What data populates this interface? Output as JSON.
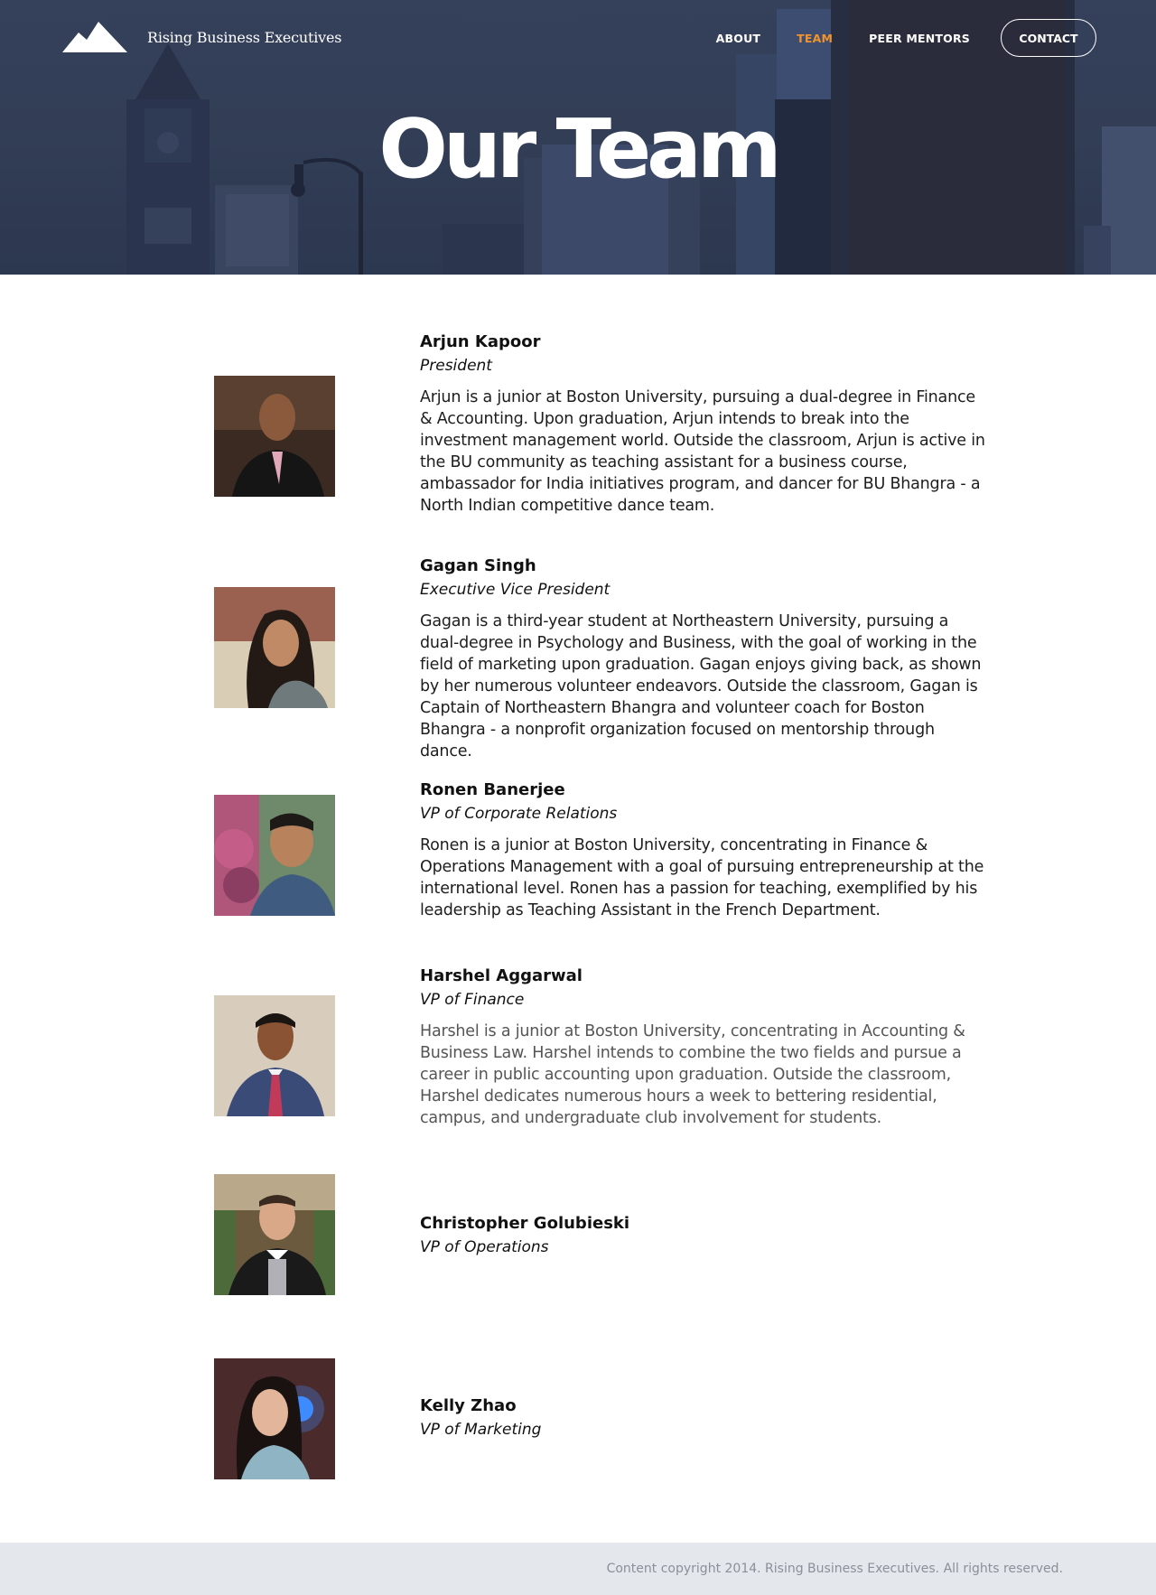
{
  "site": {
    "brand": "Rising Business Executives",
    "logo_icon": "mountain-logo-icon"
  },
  "nav": {
    "items": [
      {
        "label": "ABOUT",
        "active": false
      },
      {
        "label": "TEAM",
        "active": true
      },
      {
        "label": "PEER MENTORS",
        "active": false
      }
    ],
    "contact_label": "CONTACT",
    "active_color": "#f0932b"
  },
  "hero": {
    "title": "Our Team"
  },
  "members": [
    {
      "name": "Arjun Kapoor",
      "role": "President",
      "bio": "Arjun is a junior at Boston University, pursuing a dual-degree in Finance & Accounting. Upon graduation, Arjun intends to break into the investment management world. Outside the classroom, Arjun is active in the BU community as teaching assistant for a business course, ambassador for India initiatives program, and dancer for BU Bhangra - a North Indian competitive dance team.",
      "photo_icon": "portrait-photo"
    },
    {
      "name": "Gagan Singh",
      "role": "Executive Vice President",
      "bio": "Gagan is a third-year student at Northeastern University, pursuing a dual-degree in Psychology and Business, with the goal of working in the field of marketing upon graduation. Gagan enjoys giving back, as shown by her numerous volunteer endeavors. Outside the classroom, Gagan is Captain of Northeastern Bhangra and volunteer coach for Boston Bhangra - a nonprofit organization focused on mentorship through dance.",
      "photo_icon": "portrait-photo"
    },
    {
      "name": "Ronen Banerjee",
      "role": "VP of Corporate Relations",
      "bio": "Ronen is a junior at Boston University, concentrating in Finance & Operations Management with a goal of pursuing entrepreneurship at the international level. Ronen has a passion for teaching, exemplified by his leadership as Teaching Assistant in the French Department.",
      "photo_icon": "portrait-photo"
    },
    {
      "name": "Harshel Aggarwal",
      "role": "VP of Finance",
      "bio": "Harshel is a junior at Boston University, concentrating in Accounting & Business Law. Harshel intends to combine the two fields and pursue a career in public accounting upon graduation. Outside the classroom, Harshel dedicates numerous hours a week to bettering residential, campus, and undergraduate club involvement for students.",
      "photo_icon": "portrait-photo"
    },
    {
      "name": "Christopher Golubieski",
      "role": "VP of Operations",
      "bio": "",
      "photo_icon": "portrait-photo"
    },
    {
      "name": "Kelly Zhao",
      "role": "VP of Marketing",
      "bio": "",
      "photo_icon": "portrait-photo"
    }
  ],
  "footer": {
    "copyright": "Content copyright 2014. Rising Business Executives. All rights reserved."
  }
}
